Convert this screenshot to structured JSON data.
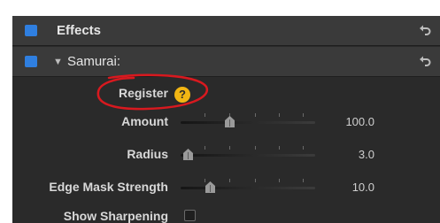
{
  "colors": {
    "panel_bg": "#2a2a2a",
    "header_bg": "#3a3a3a",
    "accent_blue": "#2f7fe0",
    "help_yellow": "#f2b613",
    "annotation_red": "#d8191f"
  },
  "effects_header": {
    "title": "Effects",
    "checkbox_checked": true,
    "reset_icon": "reset-arrow-icon"
  },
  "effect_row": {
    "disclosure": "▼",
    "title": "Samurai:",
    "checkbox_checked": true,
    "reset_icon": "reset-arrow-icon"
  },
  "register": {
    "label": "Register",
    "help_icon": "question-mark-icon",
    "help_glyph": "?"
  },
  "params": [
    {
      "label": "Amount",
      "value": "100.0",
      "slider_fraction": 0.36
    },
    {
      "label": "Radius",
      "value": "3.0",
      "slider_fraction": 0.05
    },
    {
      "label": "Edge Mask Strength",
      "value": "10.0",
      "slider_fraction": 0.22
    }
  ],
  "show_sharpening": {
    "label": "Show Sharpening",
    "checked": false
  }
}
